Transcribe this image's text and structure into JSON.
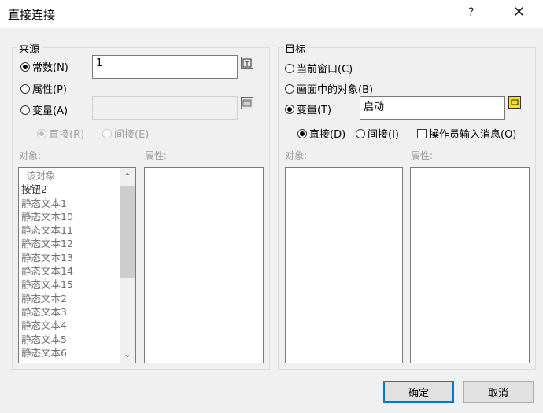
{
  "window": {
    "title": "直接连接",
    "help": "?",
    "close": "✕"
  },
  "source": {
    "title": "来源",
    "options": {
      "constant": "常数(N)",
      "property": "属性(P)",
      "variable": "变量(A)"
    },
    "constant_value": "1",
    "variable_value": "",
    "mode": {
      "direct": "直接(R)",
      "indirect": "间接(E)"
    },
    "object_label": "对象:",
    "property_label": "属性:",
    "objects": [
      "该对象",
      "按钮2",
      "静态文本1",
      "静态文本10",
      "静态文本11",
      "静态文本12",
      "静态文本13",
      "静态文本14",
      "静态文本15",
      "静态文本2",
      "静态文本3",
      "静态文本4",
      "静态文本5",
      "静态文本6"
    ]
  },
  "target": {
    "title": "目标",
    "options": {
      "current_window": "当前窗口(C)",
      "object_in_screen": "画面中的对象(B)",
      "variable": "变量(T)"
    },
    "variable_value": "启动",
    "mode": {
      "direct": "直接(D)",
      "indirect": "间接(I)",
      "operator_msg": "操作员输入消息(O)"
    },
    "object_label": "对象:",
    "property_label": "属性:"
  },
  "buttons": {
    "ok": "确定",
    "cancel": "取消"
  }
}
